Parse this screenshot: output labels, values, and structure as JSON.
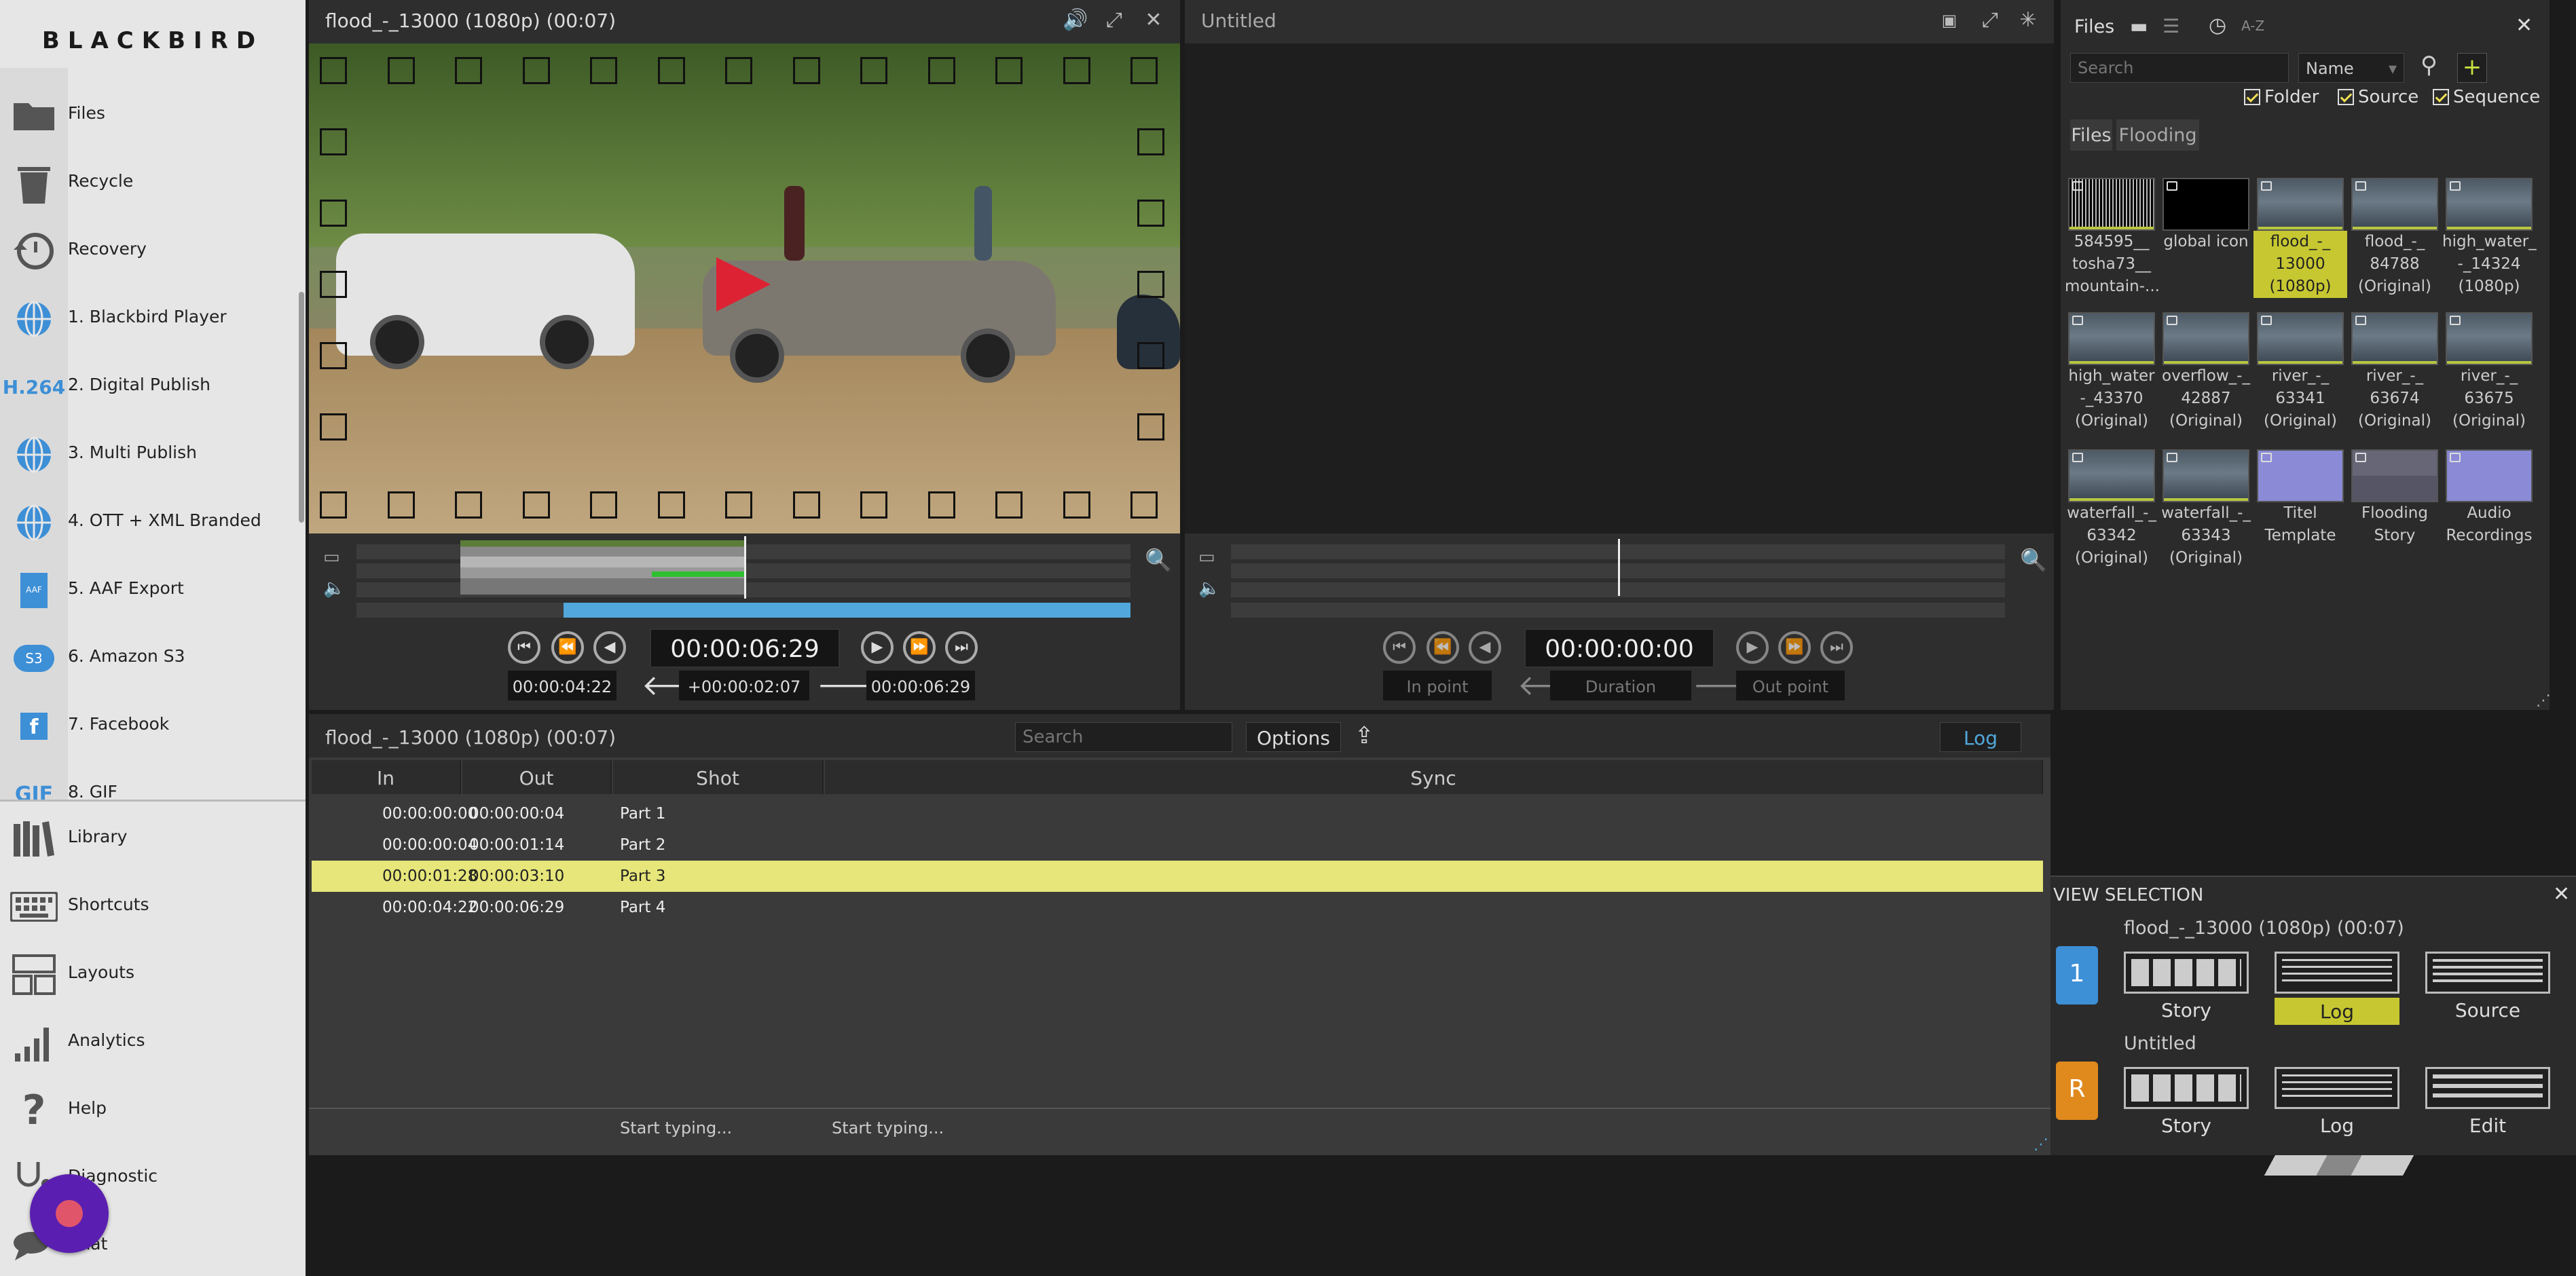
{
  "sidebar": {
    "logo": "BLACKBIRD",
    "items": [
      {
        "label": "Files",
        "icon": "folder-icon"
      },
      {
        "label": "Recycle",
        "icon": "recycle-bin-icon"
      },
      {
        "label": "Recovery",
        "icon": "history-icon"
      },
      {
        "label": "1. Blackbird Player",
        "icon": "globe-icon"
      },
      {
        "label": "2. Digital Publish",
        "icon": "h264-icon",
        "icon_text": "H.264"
      },
      {
        "label": "3. Multi Publish",
        "icon": "globe-icon"
      },
      {
        "label": "4. OTT + XML Branded",
        "icon": "globe-icon"
      },
      {
        "label": "5. AAF Export",
        "icon": "aaf-file-icon",
        "icon_text": "AAF"
      },
      {
        "label": "6. Amazon S3",
        "icon": "s3-cloud-icon",
        "icon_text": "S3"
      },
      {
        "label": "7. Facebook",
        "icon": "facebook-icon",
        "icon_text": "f"
      },
      {
        "label": "8. GIF",
        "icon": "gif-icon",
        "icon_text": "GIF"
      }
    ],
    "bottom_items": [
      {
        "label": "Library",
        "icon": "library-icon"
      },
      {
        "label": "Shortcuts",
        "icon": "keyboard-icon"
      },
      {
        "label": "Layouts",
        "icon": "layouts-icon"
      },
      {
        "label": "Analytics",
        "icon": "bar-chart-icon"
      },
      {
        "label": "Help",
        "icon": "question-icon"
      },
      {
        "label": "Diagnostic",
        "icon": "stethoscope-icon"
      },
      {
        "label": "Chat",
        "icon": "chat-icon"
      }
    ]
  },
  "player": {
    "title": "flood_-_13000 (1080p) (00:07)",
    "timecode": "00:00:06:29",
    "in_point": "00:00:04:22",
    "duration": "+00:00:02:07",
    "out_point": "00:00:06:29"
  },
  "viewer2": {
    "title": "Untitled",
    "timecode": "00:00:00:00",
    "in_point": "In point",
    "duration": "Duration",
    "out_point": "Out point"
  },
  "files": {
    "tab": "Files",
    "sort_label": "A-Z",
    "search_placeholder": "Search",
    "sort_select": "Name",
    "filters": [
      "Folder",
      "Source",
      "Sequence"
    ],
    "breadcrumb": [
      "Files",
      "Flooding"
    ],
    "thumbs": [
      {
        "caption": "584595__\ntosha73__\nmountain-...",
        "kind": "audio"
      },
      {
        "caption": "global icon",
        "kind": "image"
      },
      {
        "caption": "flood_-_\n13000\n(1080p)",
        "kind": "video",
        "selected": true
      },
      {
        "caption": "flood_-_\n84788\n(Original)",
        "kind": "video"
      },
      {
        "caption": "high_water_\n-_14324\n(1080p)",
        "kind": "video"
      },
      {
        "caption": "high_water\n-_43370\n(Original)",
        "kind": "video"
      },
      {
        "caption": "overflow_-_\n42887\n(Original)",
        "kind": "video"
      },
      {
        "caption": "river_-_\n63341\n(Original)",
        "kind": "video"
      },
      {
        "caption": "river_-_\n63674\n(Original)",
        "kind": "video"
      },
      {
        "caption": "river_-_\n63675\n(Original)",
        "kind": "video"
      },
      {
        "caption": "waterfall_-_\n63342\n(Original)",
        "kind": "video"
      },
      {
        "caption": "waterfall_-_\n63343\n(Original)",
        "kind": "video"
      },
      {
        "caption": "Titel\nTemplate",
        "kind": "folder"
      },
      {
        "caption": "Flooding\nStory",
        "kind": "story"
      },
      {
        "caption": "Audio\nRecordings",
        "kind": "folder"
      }
    ]
  },
  "log": {
    "title": "flood_-_13000 (1080p) (00:07)",
    "search_placeholder": "Search",
    "options_label": "Options",
    "mode_label": "Log",
    "columns": [
      "In",
      "Out",
      "Shot",
      "Sync"
    ],
    "rows": [
      {
        "in": "00:00:00:00",
        "out": "00:00:00:04",
        "shot": "Part 1"
      },
      {
        "in": "00:00:00:04",
        "out": "00:00:01:14",
        "shot": "Part 2"
      },
      {
        "in": "00:00:01:28",
        "out": "00:00:03:10",
        "shot": "Part 3",
        "selected": true
      },
      {
        "in": "00:00:04:22",
        "out": "00:00:06:29",
        "shot": "Part 4"
      }
    ],
    "footer_shot": "Start typing...",
    "footer_sync": "Start typing..."
  },
  "view_selection": {
    "title": "VIEW SELECTION",
    "row1": {
      "badge": "1",
      "name": "flood_-_13000 (1080p) (00:07)",
      "options": [
        "Story",
        "Log",
        "Source"
      ],
      "active": "Log"
    },
    "row2": {
      "badge": "R",
      "name": "Untitled",
      "options": [
        "Story",
        "Log",
        "Edit"
      ]
    }
  },
  "colors": {
    "accent_blue": "#52a8dc",
    "selected_yellow": "#e6e67a",
    "badge_blue": "#3d8fd6",
    "badge_orange": "#e08a1e"
  }
}
